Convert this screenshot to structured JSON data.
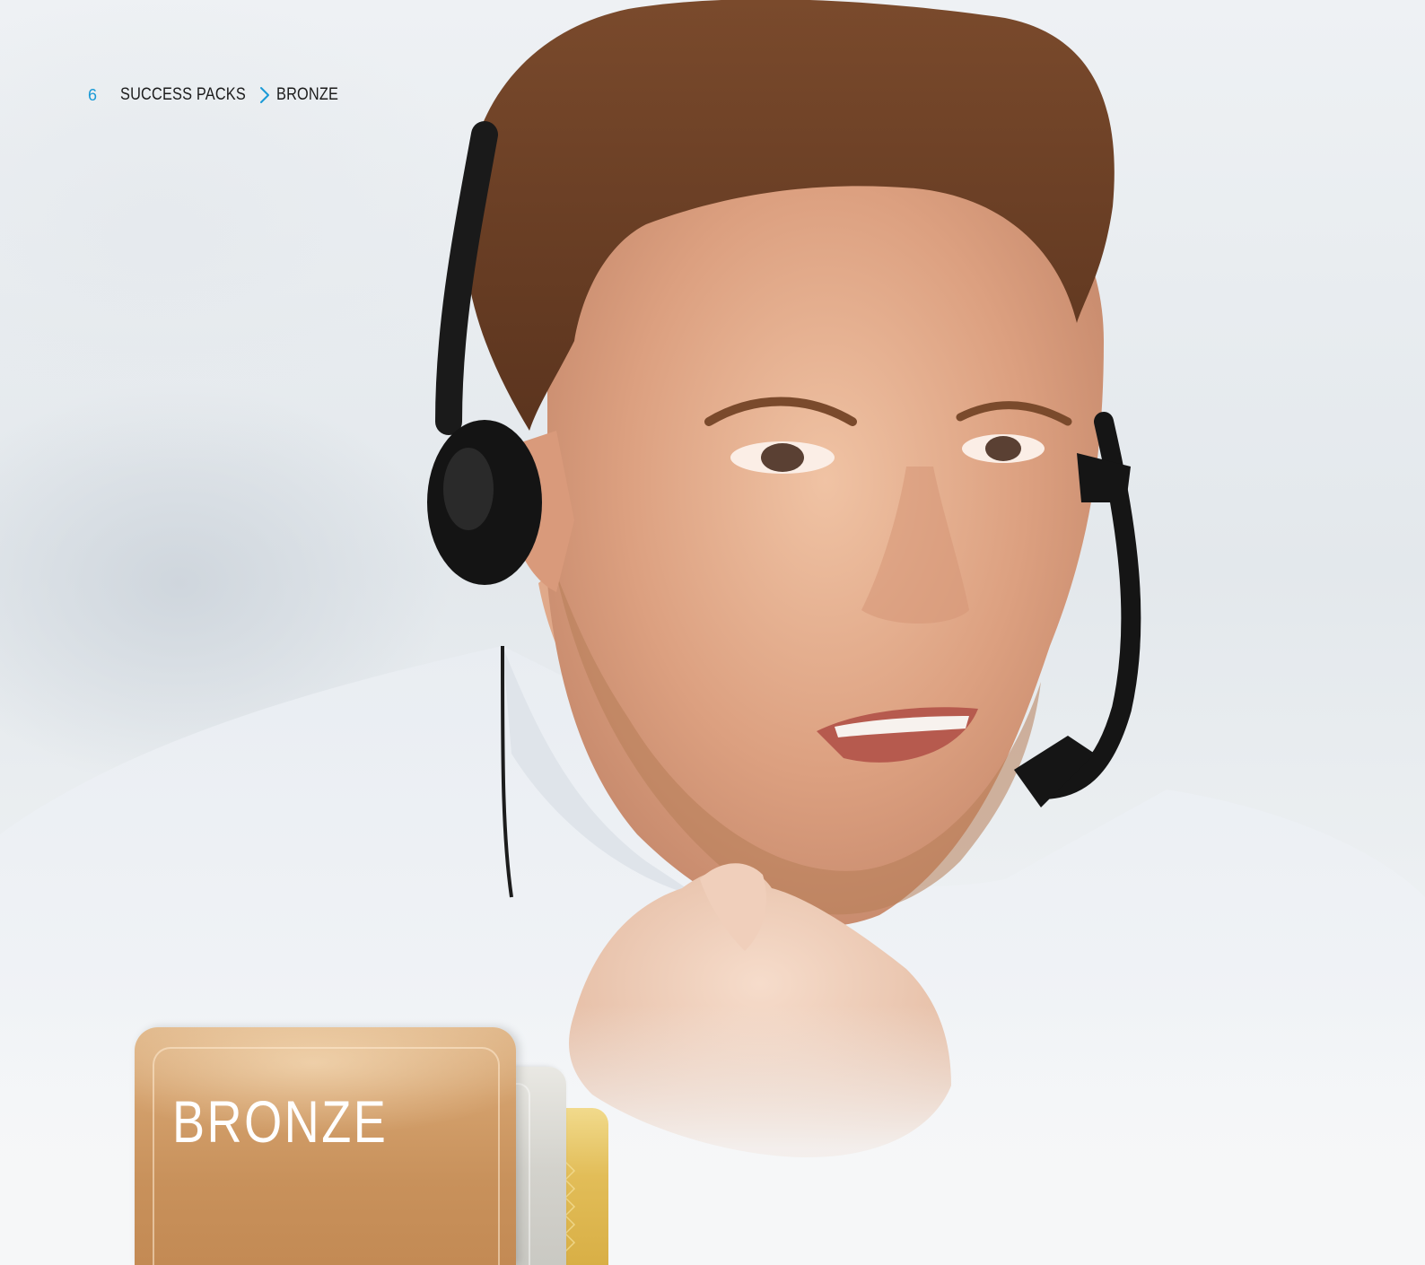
{
  "header": {
    "page_number": "6",
    "section": "SUCCESS PACKS",
    "current": "BRONZE"
  },
  "cards": {
    "bronze_title": "BRONZE"
  },
  "icons": {
    "breadcrumb_separator": "chevron-right-icon"
  },
  "colors": {
    "accent": "#1a9ad6",
    "bronze": "#c8915b",
    "silver": "#d3d2cc",
    "gold": "#e2bd58"
  }
}
